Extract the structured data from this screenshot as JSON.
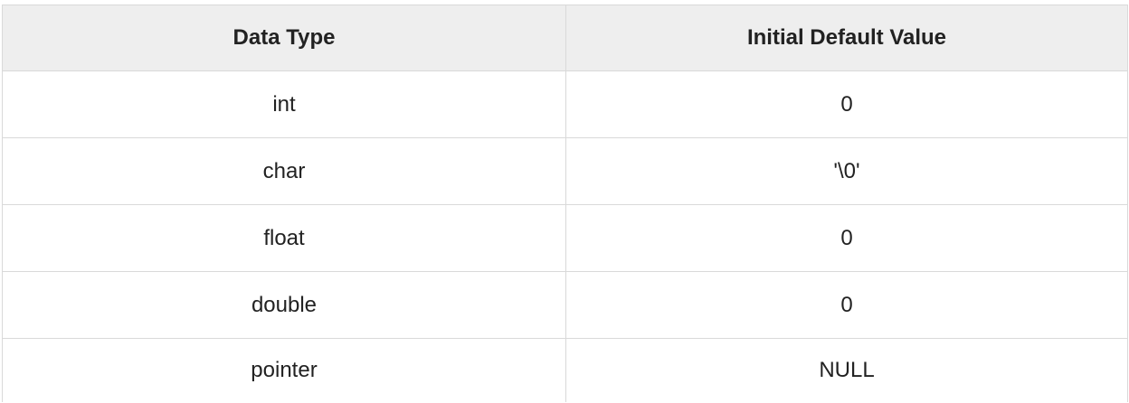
{
  "table": {
    "headers": [
      "Data Type",
      "Initial Default Value"
    ],
    "rows": [
      [
        "int",
        "0"
      ],
      [
        "char",
        "'\\0'"
      ],
      [
        "float",
        "0"
      ],
      [
        "double",
        "0"
      ],
      [
        "pointer",
        "NULL"
      ]
    ]
  }
}
